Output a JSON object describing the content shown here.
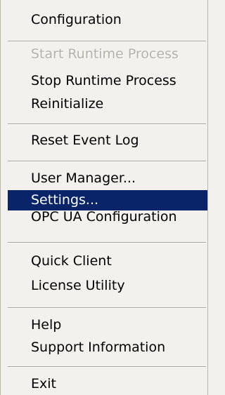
{
  "menu": {
    "items": [
      {
        "label": "Configuration",
        "enabled": true,
        "selected": false
      },
      {
        "label": "Start Runtime Process",
        "enabled": false,
        "selected": false
      },
      {
        "label": "Stop Runtime Process",
        "enabled": true,
        "selected": false
      },
      {
        "label": "Reinitialize",
        "enabled": true,
        "selected": false
      },
      {
        "label": "Reset Event Log",
        "enabled": true,
        "selected": false
      },
      {
        "label": "User Manager...",
        "enabled": true,
        "selected": false
      },
      {
        "label": "Settings...",
        "enabled": true,
        "selected": true
      },
      {
        "label": "OPC UA Configuration",
        "enabled": true,
        "selected": false
      },
      {
        "label": "Quick Client",
        "enabled": true,
        "selected": false
      },
      {
        "label": "License Utility",
        "enabled": true,
        "selected": false
      },
      {
        "label": "Help",
        "enabled": true,
        "selected": false
      },
      {
        "label": "Support Information",
        "enabled": true,
        "selected": false
      },
      {
        "label": "Exit",
        "enabled": true,
        "selected": false
      }
    ]
  },
  "colors": {
    "menu_background": "#f2f1ed",
    "selection_background": "#0a246a",
    "selection_text": "#ffffff",
    "disabled_text": "#b4b1aa",
    "separator": "#a7a49c"
  }
}
